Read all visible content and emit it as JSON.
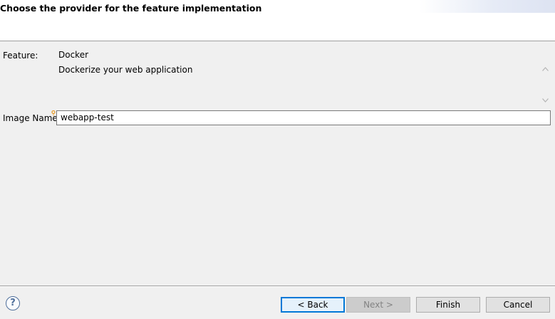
{
  "header": {
    "title": "Choose the provider for the feature implementation"
  },
  "form": {
    "feature_label": "Feature:",
    "feature_value": "Docker",
    "feature_description": "Dockerize your web application",
    "image_name_label": "Image Name:",
    "image_name_value": "webapp-test"
  },
  "scrollbar": {
    "up_icon": "chevron-up-icon",
    "down_icon": "chevron-down-icon"
  },
  "footer": {
    "help_icon": "question-mark-icon",
    "help_glyph": "?",
    "back_label": "< Back",
    "next_label": "Next >",
    "finish_label": "Finish",
    "cancel_label": "Cancel"
  },
  "colors": {
    "dialog_bg": "#f0f0f0",
    "header_bg": "#ffffff",
    "default_button_border": "#0078d7",
    "disabled_button_bg": "#cccccc",
    "required_marker": "#e8a033"
  }
}
